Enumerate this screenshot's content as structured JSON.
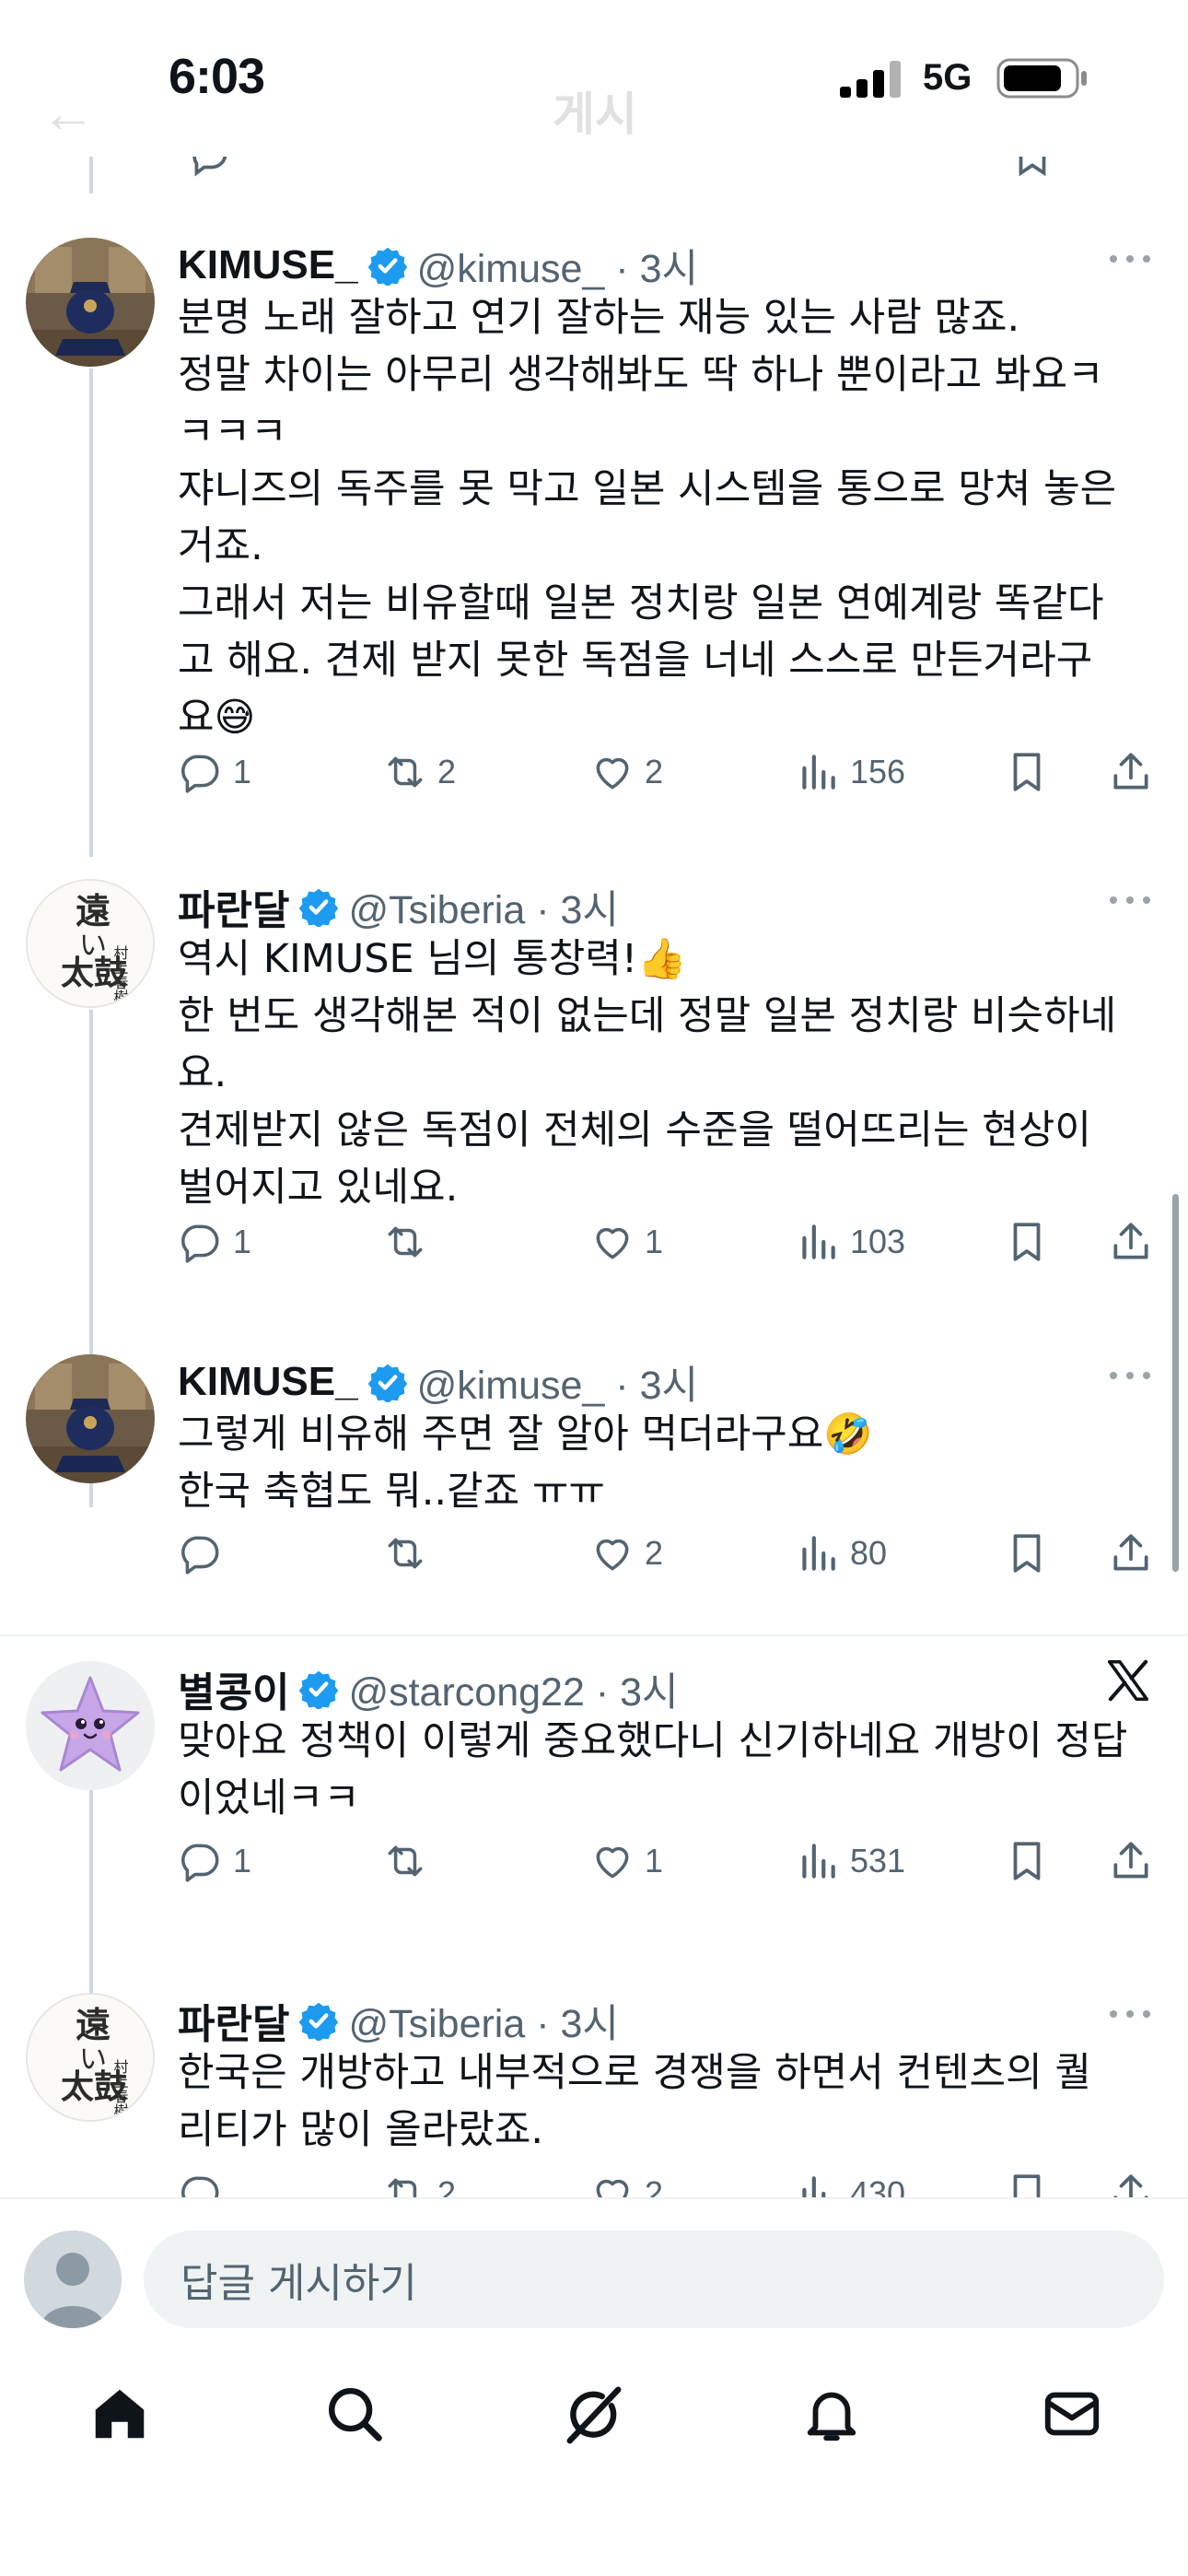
{
  "status_bar": {
    "time": "6:03",
    "network": "5G"
  },
  "header": {
    "back_icon": "back-arrow-icon",
    "title": "게시"
  },
  "tweets": [
    {
      "name": "KIMUSE_",
      "handle": "@kimuse_ · 3시",
      "lines": [
        "분명 노래 잘하고 연기 잘하는 재능 있는 사람 많죠.",
        "정말 차이는 아무리 생각해봐도 딱 하나 뿐이라고 봐요ㅋ",
        "ㅋㅋㅋ",
        "쟈니즈의 독주를 못 막고 일본 시스템을 통으로 망쳐 놓은",
        "거죠.",
        "그래서 저는 비유할때 일본 정치랑 일본 연예계랑 똑같다",
        "고 해요. 견제 받지 못한 독점을 너네 스스로 만든거라구",
        "요😅"
      ],
      "replies": "1",
      "reposts": "2",
      "likes": "2",
      "views": "156"
    },
    {
      "name": "파란달",
      "handle": "@Tsiberia · 3시",
      "lines": [
        "역시 KIMUSE 님의 통창력!👍",
        "한 번도 생각해본 적이 없는데 정말 일본 정치랑 비슷하네",
        "요.",
        "견제받지 않은 독점이 전체의 수준을 떨어뜨리는 현상이",
        "벌어지고 있네요."
      ],
      "replies": "1",
      "reposts": "",
      "likes": "1",
      "views": "103"
    },
    {
      "name": "KIMUSE_",
      "handle": "@kimuse_ · 3시",
      "lines": [
        "그렇게 비유해 주면 잘 알아 먹더라구요🤣",
        "한국 축협도 뭐..같죠 ㅠㅠ"
      ],
      "replies": "",
      "reposts": "",
      "likes": "2",
      "views": "80"
    },
    {
      "name": "별콩이",
      "handle": "@starcong22 · 3시",
      "lines": [
        "맞아요 정책이 이렇게 중요했다니 신기하네요 개방이 정답",
        "이었네ㅋㅋ"
      ],
      "replies": "1",
      "reposts": "",
      "likes": "1",
      "views": "531"
    },
    {
      "name": "파란달",
      "handle": "@Tsiberia · 3시",
      "lines": [
        "한국은 개방하고 내부적으로 경쟁을 하면서 컨텐츠의 퀄",
        "리티가 많이 올라랐죠."
      ],
      "replies": "",
      "reposts": "2",
      "likes": "2",
      "views": "430"
    }
  ],
  "avatar_art": {
    "calligraphy": "遠い太鼓",
    "author": "村上春樹"
  },
  "reply_bar": {
    "placeholder": "답글 게시하기"
  },
  "tabs": [
    "home-icon",
    "search-icon",
    "grok-icon",
    "notifications-icon",
    "messages-icon"
  ],
  "colors": {
    "verified": "#1d9bf0",
    "muted": "#536471",
    "text": "#0f1419",
    "divider": "#eff3f4"
  }
}
